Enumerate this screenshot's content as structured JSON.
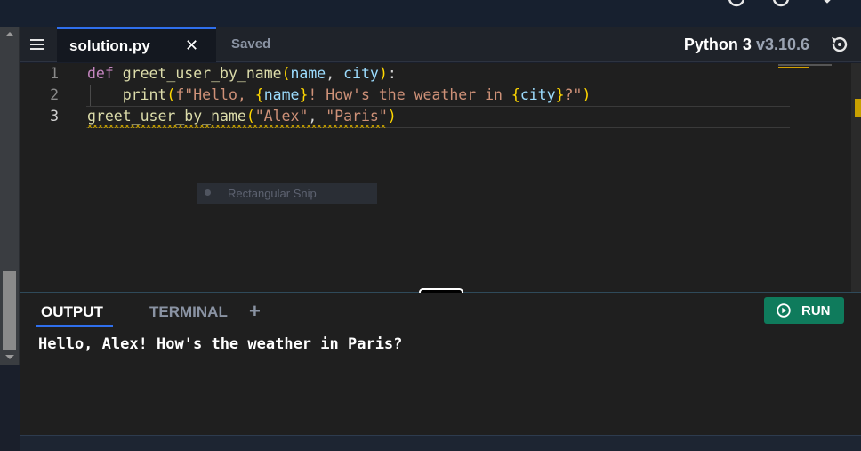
{
  "tab": {
    "filename": "solution.py",
    "close_glyph": "✕",
    "status": "Saved"
  },
  "language": {
    "name": "Python 3",
    "version": "v3.10.6"
  },
  "editor": {
    "line_numbers": [
      "1",
      "2",
      "3"
    ],
    "lines": [
      [
        [
          "kw",
          "def"
        ],
        [
          "pu",
          " "
        ],
        [
          "fn",
          "greet_user_by_name"
        ],
        [
          "br",
          "("
        ],
        [
          "pm",
          "name"
        ],
        [
          "pu",
          ", "
        ],
        [
          "pm",
          "city"
        ],
        [
          "br",
          ")"
        ],
        [
          "pu",
          ":"
        ]
      ],
      [
        [
          "pu",
          "    "
        ],
        [
          "fn",
          "print"
        ],
        [
          "br",
          "("
        ],
        [
          "st",
          "f\"Hello, "
        ],
        [
          "br",
          "{"
        ],
        [
          "pm",
          "name"
        ],
        [
          "br",
          "}"
        ],
        [
          "st",
          "! How's the weather in "
        ],
        [
          "br",
          "{"
        ],
        [
          "pm",
          "city"
        ],
        [
          "br",
          "}"
        ],
        [
          "st",
          "?\""
        ],
        [
          "br",
          ")"
        ]
      ],
      [
        [
          "fn",
          "greet_user_by_name"
        ],
        [
          "br",
          "("
        ],
        [
          "st",
          "\"Alex\""
        ],
        [
          "pu",
          ", "
        ],
        [
          "st",
          "\"Paris\""
        ],
        [
          "br",
          ")"
        ]
      ]
    ]
  },
  "overlay": {
    "snip_label": "Rectangular Snip"
  },
  "output_panel": {
    "tabs": {
      "output": "OUTPUT",
      "terminal": "TERMINAL",
      "add": "+"
    },
    "run_label": "RUN",
    "result": "Hello, Alex! How's the weather in Paris?"
  },
  "colors": {
    "accent": "#2f6fed",
    "run_green": "#0f7b5c",
    "editor_bg": "#1f1f1f"
  },
  "icons": [
    "gear-icon",
    "close-icon",
    "hamburger-menu-icon",
    "reset-icon",
    "play-circle-icon",
    "add-icon"
  ]
}
